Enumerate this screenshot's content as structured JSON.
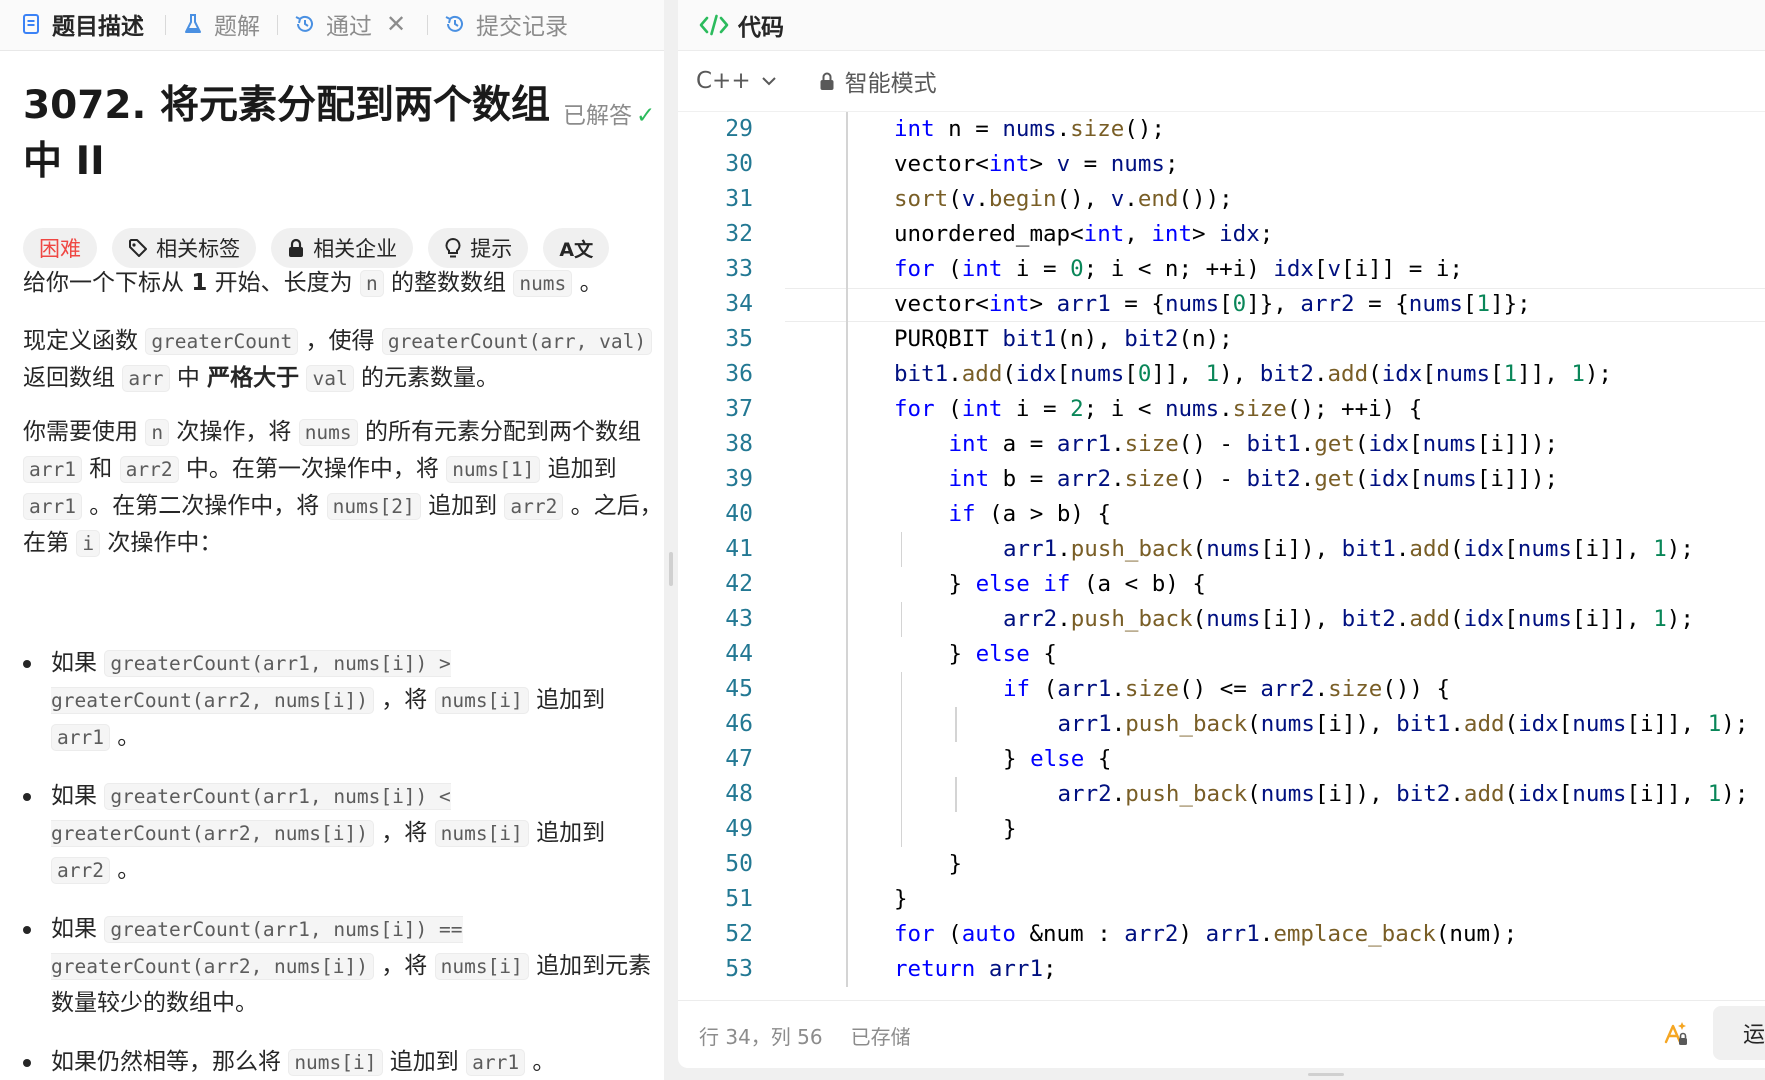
{
  "tabs": [
    {
      "label": "题目描述",
      "icon": "description-icon",
      "active": true
    },
    {
      "label": "题解",
      "icon": "flask-icon",
      "active": false
    },
    {
      "label": "通过",
      "icon": "history-icon",
      "active": false
    },
    {
      "label": "提交记录",
      "icon": "history-icon",
      "active": false
    }
  ],
  "problem": {
    "title": "3072. 将元素分配到两个数组中 II",
    "solved_label": "已解答",
    "chips": {
      "difficulty": "困难",
      "tags": "相关标签",
      "companies": "相关企业",
      "hint": "提示",
      "translate": "A文"
    },
    "p1": [
      "给你一个下标从 ",
      "1",
      " 开始、长度为 ",
      "n",
      " 的整数数组 ",
      "nums",
      " 。"
    ],
    "p2": [
      "现定义函数 ",
      "greaterCount",
      " ，使得 ",
      "greaterCount(arr, val)",
      " 返回数组 ",
      "arr",
      " 中 ",
      "严格大于",
      " ",
      "val",
      " 的元素数量。"
    ],
    "p3": [
      "你需要使用 ",
      "n",
      " 次操作，将 ",
      "nums",
      " 的所有元素分配到两个数组 ",
      "arr1",
      " 和 ",
      "arr2",
      " 中。在第一次操作中，将 ",
      "nums[1]",
      " 追加到 ",
      "arr1",
      " 。在第二次操作中，将 ",
      "nums[2]",
      " 追加到 ",
      "arr2",
      " 。之后，在第 ",
      "i",
      " 次操作中："
    ],
    "rules": [
      [
        "如果 ",
        "greaterCount(arr1, nums[i]) > greaterCount(arr2, nums[i])",
        " ，将 ",
        "nums[i]",
        " 追加到 ",
        "arr1",
        " 。"
      ],
      [
        "如果 ",
        "greaterCount(arr1, nums[i]) < greaterCount(arr2, nums[i])",
        " ，将 ",
        "nums[i]",
        " 追加到 ",
        "arr2",
        " 。"
      ],
      [
        "如果 ",
        "greaterCount(arr1, nums[i]) == greaterCount(arr2, nums[i])",
        " ，将 ",
        "nums[i]",
        " 追加到元素数量较少的数组中。"
      ],
      [
        "如果仍然相等，那么将 ",
        "nums[i]",
        " 追加到 ",
        "arr1",
        " 。"
      ]
    ]
  },
  "editor": {
    "title": "代码",
    "language": "C++",
    "mode": "智能模式",
    "current_line": 34,
    "lines": [
      {
        "n": "29",
        "indent": 1,
        "code": "int n = nums.size();"
      },
      {
        "n": "30",
        "indent": 1,
        "code": "vector<int> v = nums;"
      },
      {
        "n": "31",
        "indent": 1,
        "code": "sort(v.begin(), v.end());"
      },
      {
        "n": "32",
        "indent": 1,
        "code": "unordered_map<int, int> idx;"
      },
      {
        "n": "33",
        "indent": 1,
        "code": "for (int i = 0; i < n; ++i) idx[v[i]] = i;"
      },
      {
        "n": "34",
        "indent": 1,
        "code": "vector<int> arr1 = {nums[0]}, arr2 = {nums[1]};"
      },
      {
        "n": "35",
        "indent": 1,
        "code": "PURQBIT bit1(n), bit2(n);"
      },
      {
        "n": "36",
        "indent": 1,
        "code": "bit1.add(idx[nums[0]], 1), bit2.add(idx[nums[1]], 1);"
      },
      {
        "n": "37",
        "indent": 1,
        "code": "for (int i = 2; i < nums.size(); ++i) {"
      },
      {
        "n": "38",
        "indent": 2,
        "code": "int a = arr1.size() - bit1.get(idx[nums[i]]);"
      },
      {
        "n": "39",
        "indent": 2,
        "code": "int b = arr2.size() - bit2.get(idx[nums[i]]);"
      },
      {
        "n": "40",
        "indent": 2,
        "code": "if (a > b) {"
      },
      {
        "n": "41",
        "indent": 3,
        "code": "arr1.push_back(nums[i]), bit1.add(idx[nums[i]], 1);"
      },
      {
        "n": "42",
        "indent": 2,
        "code": "} else if (a < b) {"
      },
      {
        "n": "43",
        "indent": 3,
        "code": "arr2.push_back(nums[i]), bit2.add(idx[nums[i]], 1);"
      },
      {
        "n": "44",
        "indent": 2,
        "code": "} else {"
      },
      {
        "n": "45",
        "indent": 3,
        "code": "if (arr1.size() <= arr2.size()) {"
      },
      {
        "n": "46",
        "indent": 4,
        "code": "arr1.push_back(nums[i]), bit1.add(idx[nums[i]], 1);"
      },
      {
        "n": "47",
        "indent": 3,
        "code": "} else {"
      },
      {
        "n": "48",
        "indent": 4,
        "code": "arr2.push_back(nums[i]), bit2.add(idx[nums[i]], 1);"
      },
      {
        "n": "49",
        "indent": 3,
        "code": "}"
      },
      {
        "n": "50",
        "indent": 2,
        "code": "}"
      },
      {
        "n": "51",
        "indent": 1,
        "code": "}"
      },
      {
        "n": "52",
        "indent": 1,
        "code": "for (auto &num : arr2) arr1.emplace_back(num);"
      },
      {
        "n": "53",
        "indent": 1,
        "code": "return arr1;"
      }
    ]
  },
  "status": {
    "cursor": "行 34，列 56",
    "saved": "已存储",
    "run_label": "运"
  },
  "colors": {
    "accent": "#0000ff",
    "hard": "#ef4743",
    "solved": "#2cbb5d",
    "line_number": "#237893"
  }
}
